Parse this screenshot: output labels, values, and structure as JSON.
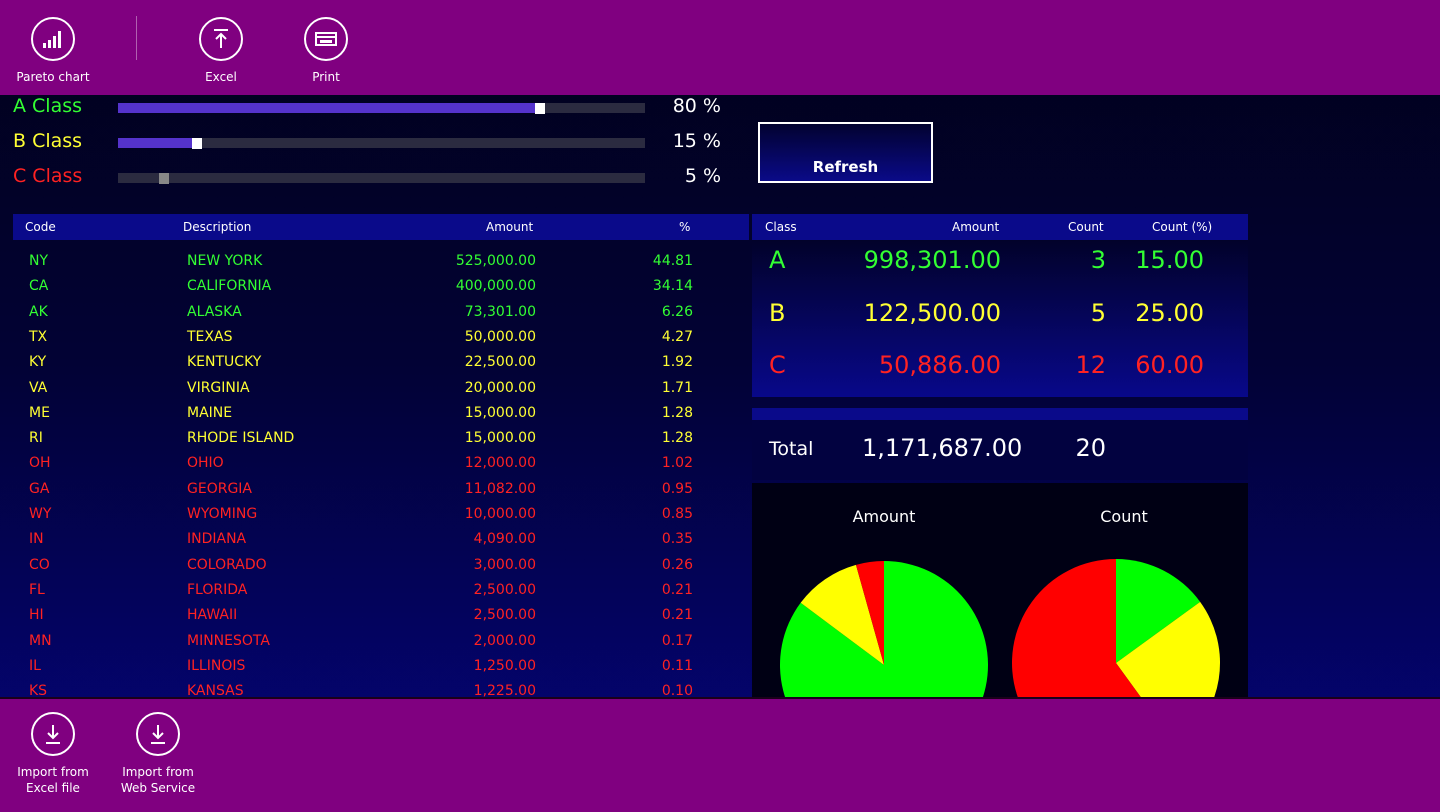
{
  "top_bar": {
    "pareto_label": "Pareto chart",
    "excel_label": "Excel",
    "print_label": "Print"
  },
  "classes": [
    {
      "label": "A Class",
      "percent_text": "80 %",
      "value": 0.8,
      "color": "#33ff33"
    },
    {
      "label": "B Class",
      "percent_text": "15 %",
      "value": 0.15,
      "color": "#ffff33"
    },
    {
      "label": "C Class",
      "percent_text": "5 %",
      "value": 0.05,
      "color": "#ff2222"
    }
  ],
  "refresh_label": "Refresh",
  "grid": {
    "headers": {
      "code": "Code",
      "description": "Description",
      "amount": "Amount",
      "percent": "%"
    },
    "rows": [
      {
        "code": "NY",
        "desc": "NEW YORK",
        "amount": "525,000.00",
        "pct": "44.81",
        "cls": "A"
      },
      {
        "code": "CA",
        "desc": "CALIFORNIA",
        "amount": "400,000.00",
        "pct": "34.14",
        "cls": "A"
      },
      {
        "code": "AK",
        "desc": "ALASKA",
        "amount": "73,301.00",
        "pct": "6.26",
        "cls": "A"
      },
      {
        "code": "TX",
        "desc": "TEXAS",
        "amount": "50,000.00",
        "pct": "4.27",
        "cls": "B"
      },
      {
        "code": "KY",
        "desc": "KENTUCKY",
        "amount": "22,500.00",
        "pct": "1.92",
        "cls": "B"
      },
      {
        "code": "VA",
        "desc": "VIRGINIA",
        "amount": "20,000.00",
        "pct": "1.71",
        "cls": "B"
      },
      {
        "code": "ME",
        "desc": "MAINE",
        "amount": "15,000.00",
        "pct": "1.28",
        "cls": "B"
      },
      {
        "code": "RI",
        "desc": "RHODE ISLAND",
        "amount": "15,000.00",
        "pct": "1.28",
        "cls": "B"
      },
      {
        "code": "OH",
        "desc": "OHIO",
        "amount": "12,000.00",
        "pct": "1.02",
        "cls": "C"
      },
      {
        "code": "GA",
        "desc": "GEORGIA",
        "amount": "11,082.00",
        "pct": "0.95",
        "cls": "C"
      },
      {
        "code": "WY",
        "desc": "WYOMING",
        "amount": "10,000.00",
        "pct": "0.85",
        "cls": "C"
      },
      {
        "code": "IN",
        "desc": "INDIANA",
        "amount": "4,090.00",
        "pct": "0.35",
        "cls": "C"
      },
      {
        "code": "CO",
        "desc": "COLORADO",
        "amount": "3,000.00",
        "pct": "0.26",
        "cls": "C"
      },
      {
        "code": "FL",
        "desc": "FLORIDA",
        "amount": "2,500.00",
        "pct": "0.21",
        "cls": "C"
      },
      {
        "code": "HI",
        "desc": "HAWAII",
        "amount": "2,500.00",
        "pct": "0.21",
        "cls": "C"
      },
      {
        "code": "MN",
        "desc": "MINNESOTA",
        "amount": "2,000.00",
        "pct": "0.17",
        "cls": "C"
      },
      {
        "code": "IL",
        "desc": "ILLINOIS",
        "amount": "1,250.00",
        "pct": "0.11",
        "cls": "C"
      },
      {
        "code": "KS",
        "desc": "KANSAS",
        "amount": "1,225.00",
        "pct": "0.10",
        "cls": "C"
      }
    ]
  },
  "class_colors": {
    "A": "#33ff33",
    "B": "#ffff33",
    "C": "#ff2222"
  },
  "summary": {
    "headers": {
      "class": "Class",
      "amount": "Amount",
      "count": "Count",
      "count_pct": "Count (%)"
    },
    "rows": [
      {
        "cls": "A",
        "amount": "998,301.00",
        "count": "3",
        "count_pct": "15.00"
      },
      {
        "cls": "B",
        "amount": "122,500.00",
        "count": "5",
        "count_pct": "25.00"
      },
      {
        "cls": "C",
        "amount": "50,886.00",
        "count": "12",
        "count_pct": "60.00"
      }
    ],
    "total_label": "Total",
    "total_amount": "1,171,687.00",
    "total_count": "20"
  },
  "chart_data": [
    {
      "type": "pie",
      "title": "Amount",
      "categories": [
        "A",
        "B",
        "C"
      ],
      "values": [
        998301.0,
        122500.0,
        50886.0
      ],
      "colors": [
        "#00ff00",
        "#ffff00",
        "#ff0000"
      ]
    },
    {
      "type": "pie",
      "title": "Count",
      "categories": [
        "A",
        "B",
        "C"
      ],
      "values": [
        3,
        5,
        12
      ],
      "colors": [
        "#00ff00",
        "#ffff00",
        "#ff0000"
      ]
    }
  ],
  "bottom_bar": {
    "import_excel_label_1": "Import from",
    "import_excel_label_2": "Excel file",
    "import_ws_label_1": "Import from",
    "import_ws_label_2": "Web Service"
  }
}
